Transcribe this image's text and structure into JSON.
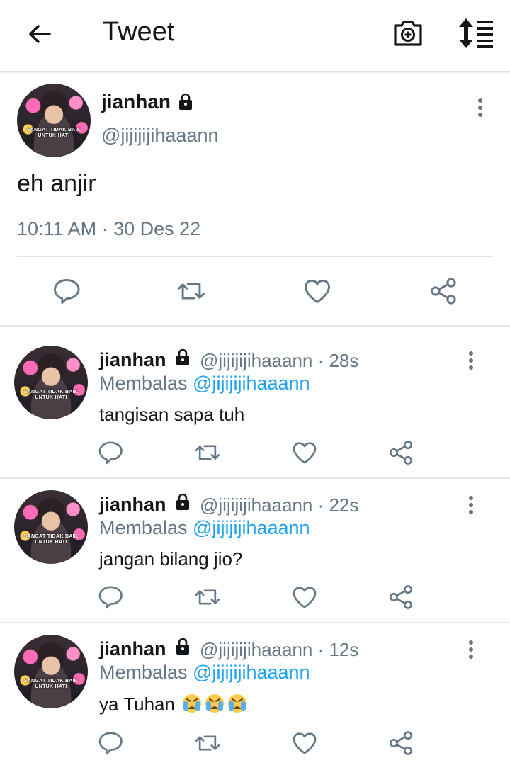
{
  "header": {
    "title": "Tweet",
    "icons": [
      "back-arrow-icon",
      "camera-plus-icon",
      "sort-icon"
    ]
  },
  "main_tweet": {
    "author_name": "jianhan",
    "handle": "@jijijijihaaann",
    "avatar_text": "SANGAT TIDAK BAIK UNTUK HATI",
    "text": "eh anjir",
    "timestamp": "10:11 AM · 30 Des 22"
  },
  "replies": [
    {
      "author_name": "jianhan",
      "handle_time": "@jijijijihaaann · 28s",
      "reply_prefix": "Membalas ",
      "reply_to": "@jijijijihaaann",
      "text": "tangisan sapa tuh",
      "emoji_count": 0
    },
    {
      "author_name": "jianhan",
      "handle_time": "@jijijijihaaann · 22s",
      "reply_prefix": "Membalas ",
      "reply_to": "@jijijijihaaann",
      "text": "jangan bilang jio?",
      "emoji_count": 0
    },
    {
      "author_name": "jianhan",
      "handle_time": "@jijijijihaaann · 12s",
      "reply_prefix": "Membalas ",
      "reply_to": "@jijijijihaaann",
      "text": "ya Tuhan ",
      "emoji_count": 3,
      "emoji": "loudly-crying-face-emoji"
    }
  ],
  "colors": {
    "text_primary": "#14171a",
    "text_secondary": "#657786",
    "link": "#1da1f2",
    "divider": "#e6ecf0"
  }
}
